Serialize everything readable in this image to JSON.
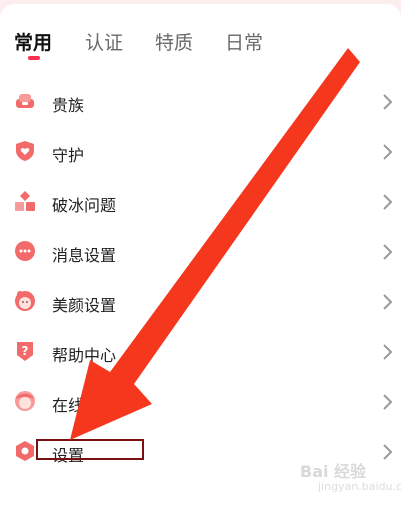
{
  "tabs": [
    {
      "label": "常用",
      "active": true
    },
    {
      "label": "认证",
      "active": false
    },
    {
      "label": "特质",
      "active": false
    },
    {
      "label": "日常",
      "active": false
    }
  ],
  "menu": {
    "items": [
      {
        "label": "贵族",
        "icon": "sofa-icon"
      },
      {
        "label": "守护",
        "icon": "shield-heart-icon"
      },
      {
        "label": "破冰问题",
        "icon": "blocks-icon"
      },
      {
        "label": "消息设置",
        "icon": "chat-bubble-icon"
      },
      {
        "label": "美颜设置",
        "icon": "girl-face-icon"
      },
      {
        "label": "帮助中心",
        "icon": "question-shield-icon"
      },
      {
        "label": "在线",
        "icon": "avatar-face-icon"
      },
      {
        "label": "设置",
        "icon": "hexagon-settings-icon"
      }
    ]
  },
  "watermark": {
    "text": "Bai 经验",
    "sub": "jingyan.baidu.com"
  },
  "colors": {
    "accent": "#ff2e4d",
    "icon": "#f36a6a",
    "arrow": "#f5371e"
  }
}
